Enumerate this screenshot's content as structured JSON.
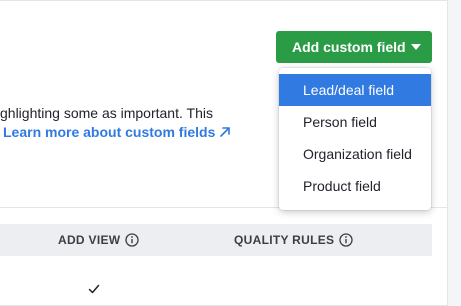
{
  "header": {
    "add_button_label": "Add custom field",
    "chevron_icon": "chevron-down-icon"
  },
  "dropdown": {
    "items": [
      {
        "label": "Lead/deal field",
        "active": true
      },
      {
        "label": "Person field",
        "active": false
      },
      {
        "label": "Organization field",
        "active": false
      },
      {
        "label": "Product field",
        "active": false
      }
    ]
  },
  "description": {
    "text": "ghlighting some as important. This",
    "link_label": "Learn more about custom fields",
    "link_icon": "external-link-arrow-icon"
  },
  "table": {
    "columns": [
      {
        "label": "ADD VIEW",
        "icon": "info-icon"
      },
      {
        "label": "QUALITY RULES",
        "icon": "info-icon"
      }
    ],
    "first_row": {
      "add_view": "check-icon"
    }
  },
  "colors": {
    "primary_green": "#2a9c46",
    "link_blue": "#317ae2",
    "highlight_blue": "#317ae2",
    "header_gray": "#eceef1"
  }
}
